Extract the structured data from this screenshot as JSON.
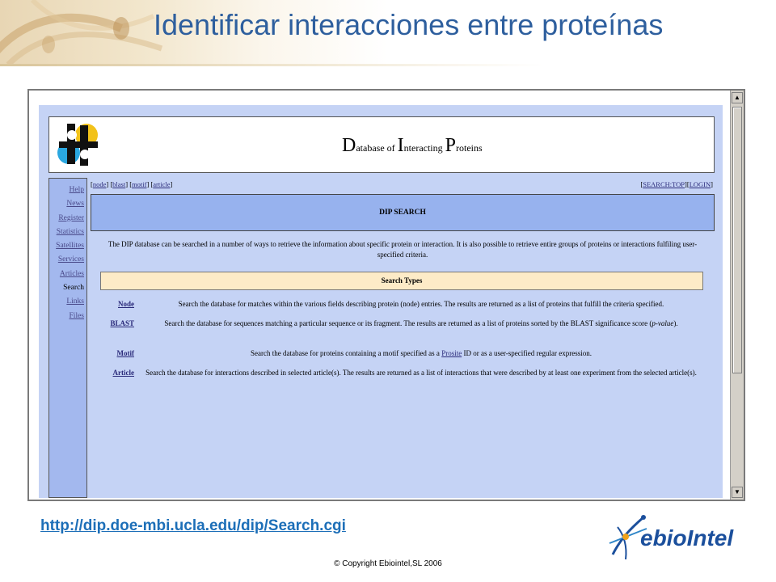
{
  "slide": {
    "title": "Identificar interacciones entre proteínas",
    "url": "http://dip.doe-mbi.ucla.edu/dip/Search.cgi",
    "copyright": "© Copyright Ebiointel,SL 2006"
  },
  "brand": {
    "logo_text_e": "e",
    "logo_text_rest": "bioIntel"
  },
  "dip": {
    "title_D": "D",
    "title_atabase_of": "atabase of",
    "title_I": "I",
    "title_nteracting": "nteracting",
    "title_P": "P",
    "title_roteins": "roteins"
  },
  "sidebar": {
    "items": [
      {
        "label": "Help"
      },
      {
        "label": "News"
      },
      {
        "label": "Register"
      },
      {
        "label": "Statistics"
      },
      {
        "label": "Satellites"
      },
      {
        "label": "Services"
      },
      {
        "label": "Articles"
      },
      {
        "label": "Search"
      },
      {
        "label": "Links"
      },
      {
        "label": "Files"
      }
    ]
  },
  "nav": {
    "left": [
      "node",
      "blast",
      "motif",
      "article"
    ],
    "right": [
      "SEARCH:TOP",
      "LOGIN"
    ]
  },
  "search": {
    "header": "DIP SEARCH",
    "intro": "The DIP database can be searched in a number of ways to retrieve the information about specific protein or interaction. It is also possible to retrieve entire groups of proteins or interactions fulfiling user-specified criteria.",
    "types_header": "Search Types",
    "types": [
      {
        "name": "Node",
        "desc": "Search the database for matches within the various fields describing protein (node) entries. The results are returned as a list of proteins that fulfill the criteria specified."
      },
      {
        "name": "BLAST",
        "desc_a": "Search the database for sequences matching a particular sequence or its fragment. The results are returned as a list of proteins sorted by the BLAST significance score (",
        "desc_em": "p-value",
        "desc_b": ")."
      },
      {
        "name": "Motif",
        "desc_a": "Search the database for proteins containing a motif specified as a ",
        "desc_link": "Prosite",
        "desc_b": " ID or as a user-specified regular expression."
      },
      {
        "name": "Article",
        "desc": "Search the database for interactions described in selected article(s). The results are returned as a list of interactions that were described by at least one experiment from the selected article(s)."
      }
    ]
  },
  "colors": {
    "title_blue": "#2e5f9e",
    "page_bg": "#c5d3f5",
    "sidebar_bg": "#a3b8ee",
    "header_bg": "#97b2ee",
    "types_bg": "#fdebc7",
    "url_blue": "#1d6fb8"
  }
}
